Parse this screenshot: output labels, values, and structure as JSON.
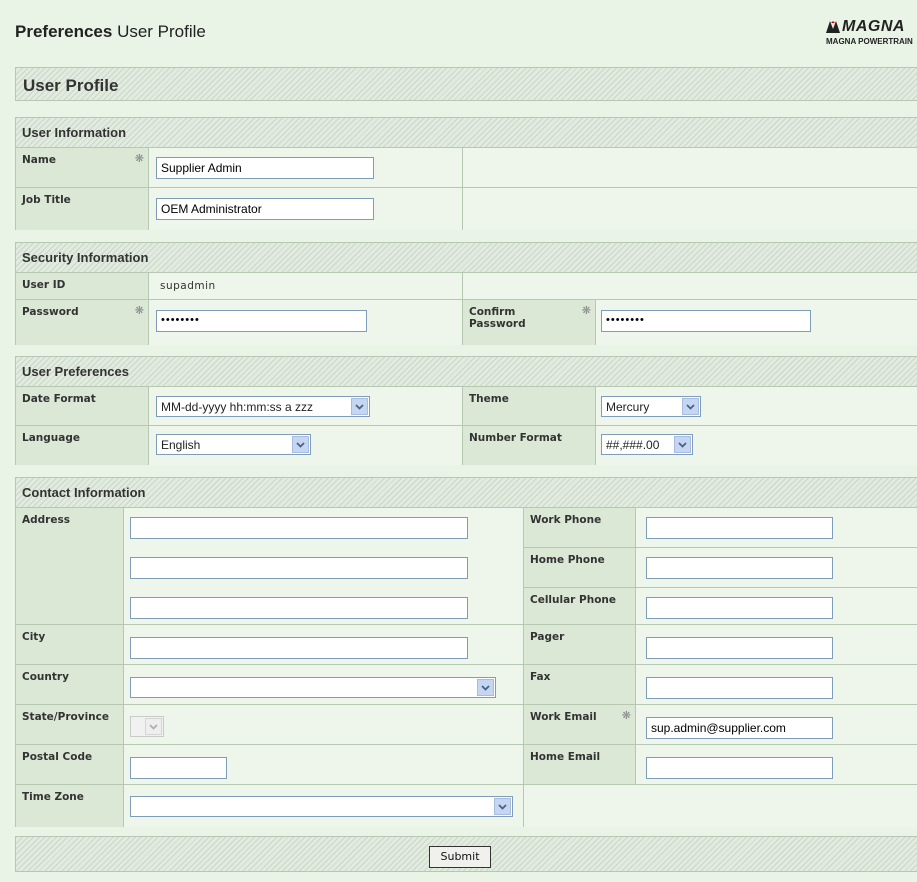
{
  "header": {
    "title_bold": "Preferences",
    "title_rest": " User Profile",
    "logo_top": "MAGNA",
    "logo_bottom": "MAGNA POWERTRAIN"
  },
  "profile_title": "User Profile",
  "user_info": {
    "heading": "User Information",
    "name_label": "Name",
    "name_value": "Supplier Admin",
    "job_label": "Job Title",
    "job_value": "OEM Administrator"
  },
  "security": {
    "heading": "Security Information",
    "userid_label": "User ID",
    "userid_value": "supadmin",
    "password_label": "Password",
    "password_value": "••••••••",
    "confirm_label": "Confirm Password",
    "confirm_value": "••••••••"
  },
  "prefs": {
    "heading": "User Preferences",
    "date_label": "Date Format",
    "date_value": "MM-dd-yyyy hh:mm:ss a zzz",
    "theme_label": "Theme",
    "theme_value": "Mercury",
    "lang_label": "Language",
    "lang_value": "English",
    "number_label": "Number Format",
    "number_value": "##,###.00"
  },
  "contact": {
    "heading": "Contact Information",
    "address_label": "Address",
    "city_label": "City",
    "country_label": "Country",
    "country_value": "",
    "state_label": "State/Province",
    "postal_label": "Postal Code",
    "tz_label": "Time Zone",
    "tz_value": "",
    "work_phone_label": "Work Phone",
    "home_phone_label": "Home Phone",
    "cell_label": "Cellular Phone",
    "pager_label": "Pager",
    "fax_label": "Fax",
    "work_email_label": "Work Email",
    "work_email_value": "sup.admin@supplier.com",
    "home_email_label": "Home Email"
  },
  "required_marker": "❋",
  "submit_label": "Submit"
}
